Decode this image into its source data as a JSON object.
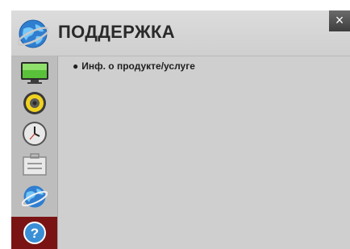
{
  "header": {
    "title": "ПОДДЕРЖКА",
    "close_glyph": "×",
    "icon": "globe-icon"
  },
  "sidebar": {
    "items": [
      {
        "name": "picture",
        "icon": "tv-screen-icon",
        "active": false
      },
      {
        "name": "audio",
        "icon": "speaker-icon",
        "active": false
      },
      {
        "name": "time",
        "icon": "clock-icon",
        "active": false
      },
      {
        "name": "setup",
        "icon": "toolbox-icon",
        "active": false
      },
      {
        "name": "network",
        "icon": "globe-icon",
        "active": false
      },
      {
        "name": "support",
        "icon": "help-icon",
        "active": true
      }
    ]
  },
  "content": {
    "bullet": "●",
    "items": [
      "Инф. о продукте/услуге"
    ]
  },
  "colors": {
    "panel": "#cfcfcf",
    "sidebar": "#bdbdbd",
    "active_item": "#7a1414",
    "help_blue": "#3a8fd6"
  }
}
